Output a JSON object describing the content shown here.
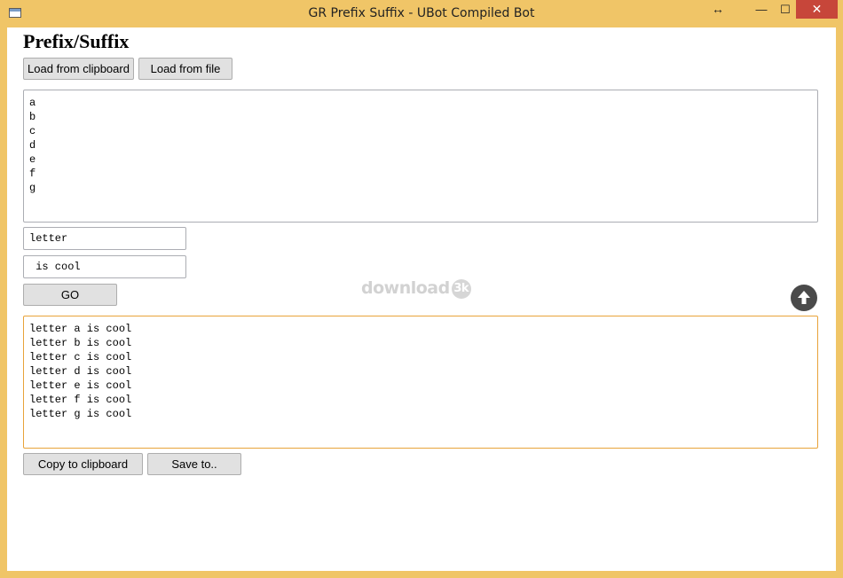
{
  "window": {
    "title": "GR Prefix Suffix - UBot Compiled Bot",
    "controls": {
      "resize_glyph": "↔",
      "minimize_glyph": "—",
      "maximize_glyph": "☐",
      "close_glyph": "✕",
      "close_color": "#c7463a"
    },
    "frame_color": "#f0c567"
  },
  "page": {
    "heading": "Prefix/Suffix",
    "load_clipboard_label": "Load from clipboard",
    "load_file_label": "Load from file",
    "input_lines": [
      "a",
      "b",
      "c",
      "d",
      "e",
      "f",
      "g"
    ],
    "prefix_value": "letter",
    "suffix_value": " is cool",
    "go_label": "GO",
    "output_lines": [
      "letter a is cool",
      "letter b is cool",
      "letter c is cool",
      "letter d is cool",
      "letter e is cool",
      "letter f is cool",
      "letter g is cool"
    ],
    "copy_label": "Copy to clipboard",
    "save_label": "Save to..",
    "watermark_text": "download",
    "watermark_badge": "3k",
    "scroll_top_icon": "arrow-up-circle-icon"
  }
}
